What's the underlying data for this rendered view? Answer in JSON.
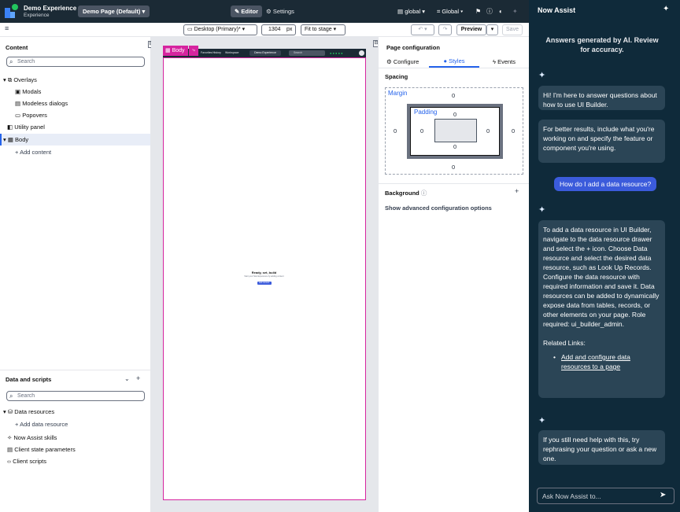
{
  "header": {
    "app_title": "Demo Experience",
    "app_subtitle": "Experience",
    "page_selector": "Demo Page (Default)",
    "editor": "Editor",
    "settings": "Settings",
    "scope": "global",
    "language": "Global"
  },
  "toolbar": {
    "viewport": "Desktop (Primary)*",
    "width_value": "1304",
    "width_unit": "px",
    "fit": "Fit to stage",
    "preview": "Preview",
    "save": "Save"
  },
  "content": {
    "title": "Content",
    "search_placeholder": "Search",
    "overlays": "Overlays",
    "modals": "Modals",
    "modeless": "Modeless dialogs",
    "popovers": "Popovers",
    "utility": "Utility panel",
    "body": "Body",
    "add_content": "Add content"
  },
  "data_scripts": {
    "title": "Data and scripts",
    "search_placeholder": "Search",
    "data_resources": "Data resources",
    "add_data_resource": "Add data resource",
    "now_assist_skills": "Now Assist skills",
    "client_state": "Client state parameters",
    "client_scripts": "Client scripts"
  },
  "stage": {
    "body_tag": "Body",
    "mini_nav": [
      "Favorites",
      "History",
      "Workspace"
    ],
    "mini_center": "Demo Experience",
    "mini_search": "Search",
    "ready_title": "Ready, set, build",
    "ready_sub": "Start your Now Experience by adding content",
    "ready_button": "Add content"
  },
  "page_config": {
    "title": "Page configuration",
    "tabs": [
      "Configure",
      "Styles",
      "Events"
    ],
    "spacing": "Spacing",
    "margin_label": "Margin",
    "padding_label": "Padding",
    "margin": {
      "top": "0",
      "right": "0",
      "bottom": "0",
      "left": "0"
    },
    "padding": {
      "top": "0",
      "right": "0",
      "bottom": "0",
      "left": "0"
    },
    "background": "Background",
    "advanced": "Show advanced configuration options"
  },
  "assist": {
    "title": "Now Assist",
    "disclaimer": "Answers generated by AI. Review for accuracy.",
    "msg1": "Hi! I'm here to answer questions about how to use UI Builder.",
    "msg2": "For better results, include what you're working on and specify the feature or component you're using.",
    "user_msg": "How do I add a data resource?",
    "answer": "To add a data resource in UI Builder, navigate to the data resource drawer and select the + icon. Choose Data resource and select the desired data resource, such as Look Up Records. Configure the data resource with required information and save it. Data resources can be added to dynamically expose data from tables, records, or other elements on your page. Role required: ui_builder_admin.",
    "related_title": "Related Links:",
    "related_link": "Add and configure data resources to a page",
    "msg3": "If you still need help with this, try rephrasing your question or ask a new one.",
    "input_placeholder": "Ask Now Assist to..."
  },
  "colors": {
    "header_bg": "#1b2a35",
    "assist_bg": "#0f2a3a",
    "bubble_bg": "#2b4556",
    "user_bubble": "#3b5bdb",
    "accent_pink": "#d6249f",
    "accent_blue": "#2563eb"
  }
}
